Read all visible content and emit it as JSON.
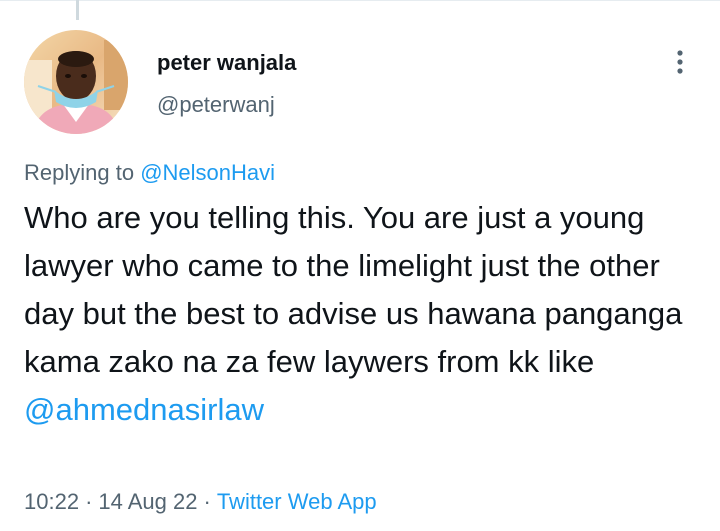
{
  "tweet": {
    "author": {
      "display_name": "peter wanjala",
      "handle": "@peterwanj"
    },
    "reply": {
      "prefix": "Replying to",
      "to_handle": "@NelsonHavi"
    },
    "text": "Who are you telling this. You are just a young lawyer who came to the limelight just the other day but the best to advise us hawana panganga kama zako na za few laywers from kk like",
    "mention": "@ahmednasirlaw",
    "time": "10:22",
    "date": "14 Aug 22",
    "separator": "·",
    "source": "Twitter Web App"
  },
  "icons": {
    "more": "more-vertical-icon",
    "avatar": "avatar-photo"
  },
  "colors": {
    "link": "#1d9bf0",
    "secondary_text": "#536471",
    "primary_text": "#0f1419"
  }
}
